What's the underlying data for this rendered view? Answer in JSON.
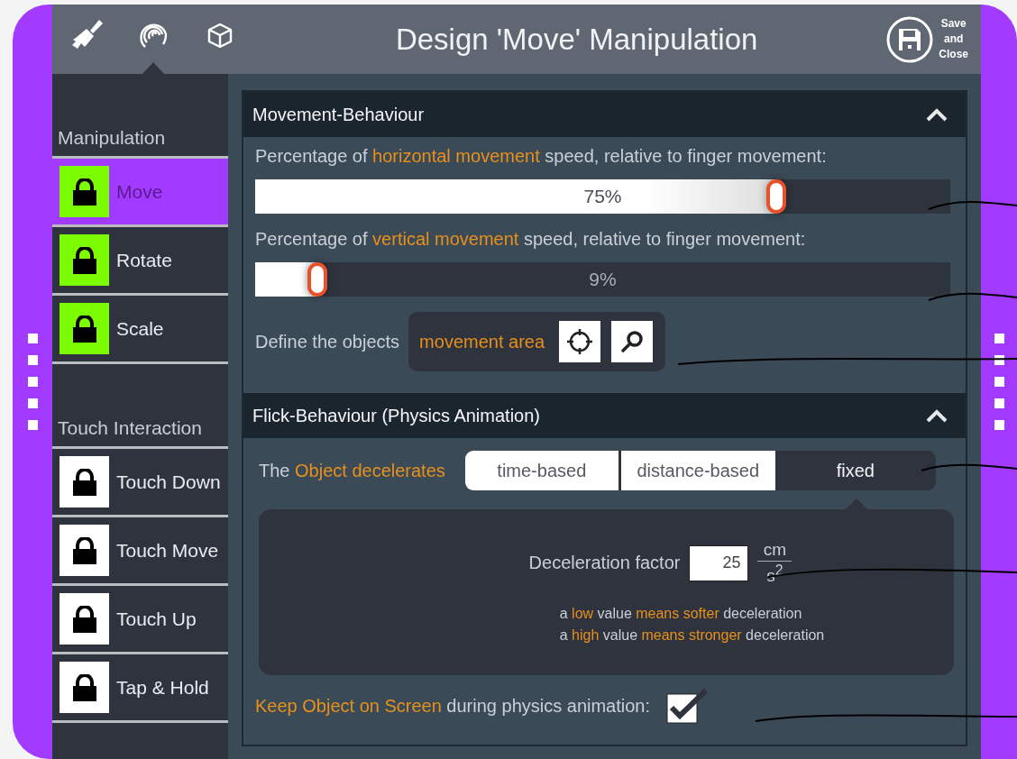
{
  "toolbar": {
    "tools": [
      {
        "kind": "brush",
        "selected": false
      },
      {
        "kind": "fingerprint",
        "selected": true
      },
      {
        "kind": "cube",
        "selected": false
      }
    ],
    "title": "Design 'Move' Manipulation",
    "save_button": {
      "label": "Save and Close"
    }
  },
  "sidebar": {
    "sections": [
      {
        "heading": "Manipulation",
        "items": [
          {
            "label": "Move",
            "selected": true,
            "active": true
          },
          {
            "label": "Rotate",
            "selected": false,
            "active": true
          },
          {
            "label": "Scale",
            "selected": false,
            "active": true
          }
        ]
      },
      {
        "heading": "Touch Interaction",
        "items": [
          {
            "label": "Touch Down",
            "selected": false,
            "active": false
          },
          {
            "label": "Touch Move",
            "selected": false,
            "active": false
          },
          {
            "label": "Touch Up",
            "selected": false,
            "active": false
          },
          {
            "label": "Tap & Hold",
            "selected": false,
            "active": false
          }
        ]
      }
    ]
  },
  "movement": {
    "title": "Movement-Behaviour",
    "expanded": true,
    "sliders": [
      {
        "label": "Percentage of **horizontal movement** speed, relative to finger movement:",
        "level": 0.75,
        "reading": "75%"
      },
      {
        "label": "Percentage of **vertical movement** speed, relative to finger movement:",
        "level": 0.09,
        "reading": "9%"
      }
    ],
    "area": {
      "label": "Define the objects",
      "value": "movement area"
    }
  },
  "flick": {
    "title": "Flick-Behaviour (Physics Animation)",
    "expanded": true,
    "deceleration": {
      "label": "The **Object decelerates**",
      "options": [
        {
          "label": "time-based",
          "selected": false
        },
        {
          "label": "distance-based",
          "selected": false
        },
        {
          "label": "fixed",
          "selected": true
        }
      ]
    },
    "factor": {
      "label": "Deceleration factor",
      "value": "25",
      "unit_top": "cm",
      "unit_bottom": "s$^{2}$"
    },
    "hints": [
      "a **low** value **means softer** deceleration",
      "a **high** value **means stronger** deceleration"
    ],
    "keep_on_screen": {
      "label": "**Keep Object on Screen** during physics animation:",
      "checked": true
    }
  }
}
